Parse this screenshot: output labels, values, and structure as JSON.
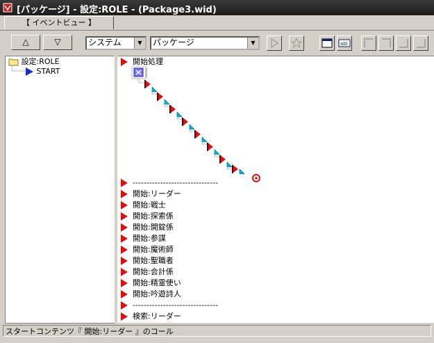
{
  "window": {
    "title": "[パッケージ] - 設定:ROLE - (Package3.wid)"
  },
  "tabs": {
    "active": "【 イベントビュー 】"
  },
  "toolbar": {
    "up_label": "△",
    "down_label": "▽",
    "system_combo": "システム",
    "package_combo": "パッケージ"
  },
  "tree": {
    "root": "設定:ROLE",
    "child": "START"
  },
  "events": {
    "head": "開始処理",
    "separator": "-------------------------------",
    "items": [
      "開始:リーダー",
      "開始:戦士",
      "開始:探索係",
      "開始:開錠係",
      "開始:参謀",
      "開始:魔術師",
      "開始:聖職者",
      "開始:会計係",
      "開始:精霊使い",
      "開始:吟遊詩人"
    ],
    "separator2": "-------------------------------",
    "search": "検索:リーダー"
  },
  "status": {
    "text": "スタートコンテンツ『 開始:リーダー 』のコール"
  }
}
